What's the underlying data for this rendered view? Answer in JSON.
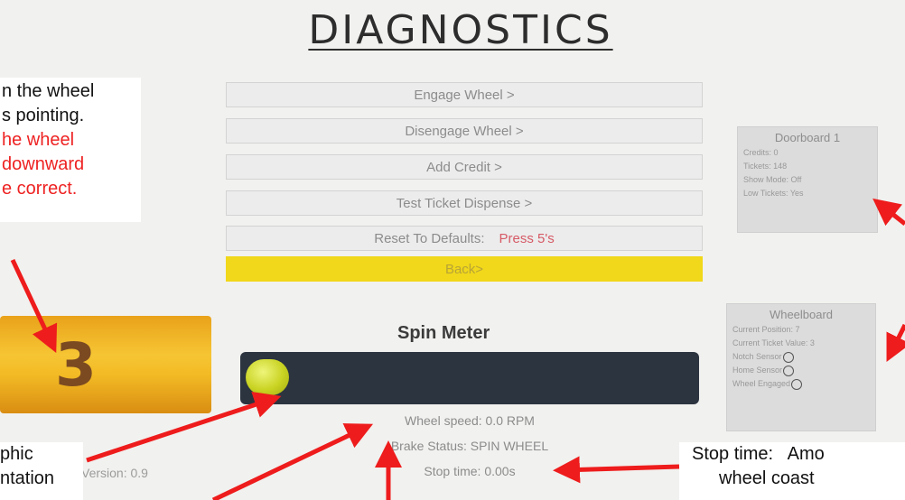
{
  "screen": {
    "title": "DIAGNOSTICS"
  },
  "menu": [
    {
      "label": "Engage Wheel >"
    },
    {
      "label": "Disengage Wheel >"
    },
    {
      "label": "Add Credit >"
    },
    {
      "label": "Test Ticket Dispense >"
    }
  ],
  "reset": {
    "label": "Reset To Defaults:",
    "action": "Press 5's"
  },
  "back": {
    "label": "Back>"
  },
  "doorboard": {
    "title": "Doorboard 1",
    "credits": "Credits: 0",
    "tickets": "Tickets: 148",
    "show_mode": "Show Mode: Off",
    "low_tickets": "Low Tickets: Yes"
  },
  "wheelboard": {
    "title": "Wheelboard",
    "current_position": "Current Position: 7",
    "current_ticket_value": "Current Ticket Value: 3",
    "notch_sensor": "Notch Sensor",
    "home_sensor": "Home Sensor",
    "wheel_engaged": "Wheel Engaged"
  },
  "wheel_graphic": {
    "value": "3"
  },
  "spin_meter": {
    "label": "Spin Meter",
    "fill_fraction": 0.0
  },
  "status": {
    "wheel_speed": "Wheel speed: 0.0 RPM",
    "brake_status": "Brake Status: SPIN WHEEL",
    "stop_time": "Stop time: 0.00s"
  },
  "version": "Version: 0.9",
  "annotations": {
    "top_left_1": "n the wheel",
    "top_left_2": "s pointing.",
    "top_left_3_red": "he wheel",
    "top_left_4_red": "downward",
    "top_left_5_red": "e correct.",
    "bottom_left_1": "phic",
    "bottom_left_2": "ntation",
    "bottom_right_1": "Stop time:   Amo",
    "bottom_right_2": "wheel coast"
  },
  "colors": {
    "accent": "#f1d81a",
    "meter": "#2c3440",
    "annotation_red": "#ee2222",
    "reset_action": "#d65a66"
  }
}
